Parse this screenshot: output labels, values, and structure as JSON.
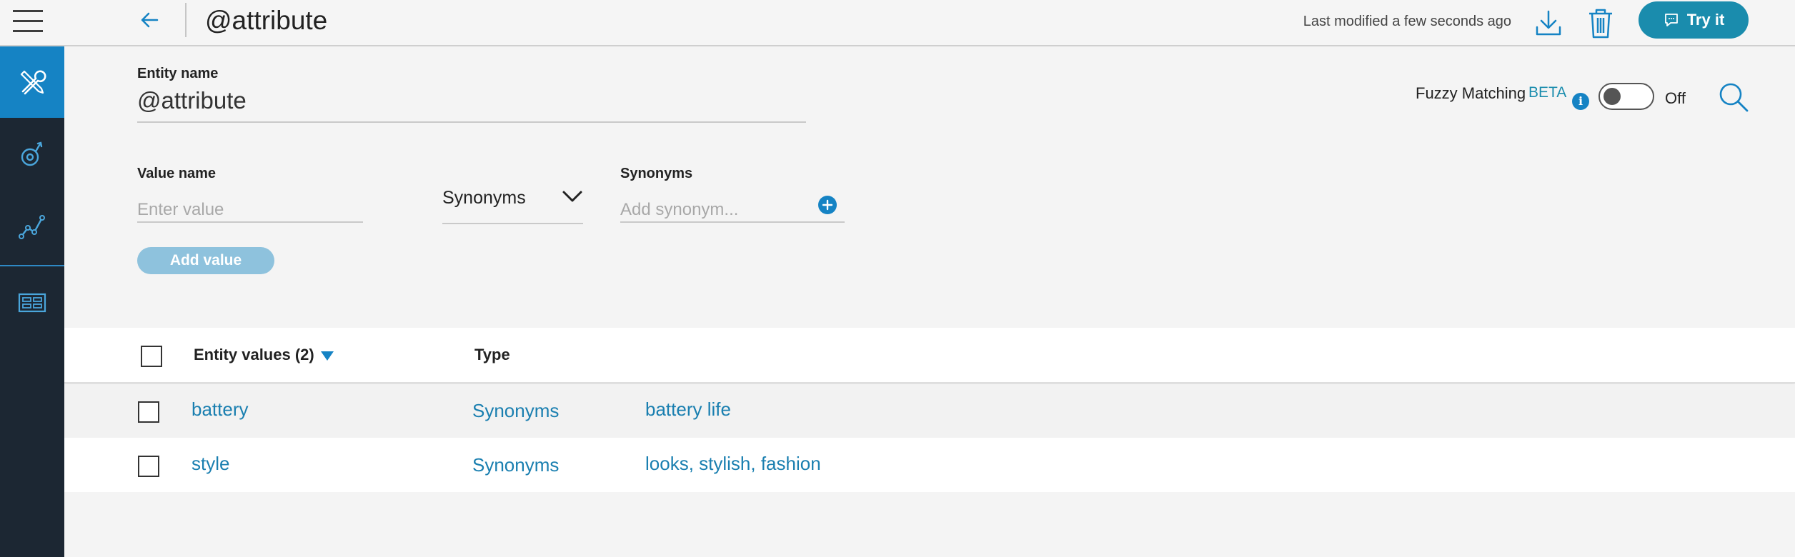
{
  "header": {
    "title": "@attribute",
    "last_modified": "Last modified a few seconds ago",
    "try_it_label": "Try it"
  },
  "sidebar": {
    "items": [
      {
        "icon": "tools-icon",
        "active": true
      },
      {
        "icon": "intents-icon",
        "active": false
      },
      {
        "icon": "analytics-icon",
        "active": false
      },
      {
        "icon": "table-grid-icon",
        "active": false
      }
    ]
  },
  "form": {
    "entity_name_label": "Entity name",
    "entity_name_value": "@attribute",
    "fuzzy_label": "Fuzzy Matching",
    "fuzzy_badge": "BETA",
    "fuzzy_state": "Off",
    "value_name_label": "Value name",
    "value_name_placeholder": "Enter value",
    "type_select_value": "Synonyms",
    "synonyms_label": "Synonyms",
    "synonyms_placeholder": "Add synonym...",
    "add_value_label": "Add value"
  },
  "table": {
    "header_values": "Entity values (2)",
    "header_type": "Type",
    "rows": [
      {
        "value": "battery",
        "type": "Synonyms",
        "synonyms": "battery life"
      },
      {
        "value": "style",
        "type": "Synonyms",
        "synonyms": "looks, stylish, fashion"
      }
    ]
  },
  "colors": {
    "accent": "#1583c4",
    "link": "#1a7fb0",
    "try_it": "#1a8cad",
    "rail": "#1c2733"
  }
}
